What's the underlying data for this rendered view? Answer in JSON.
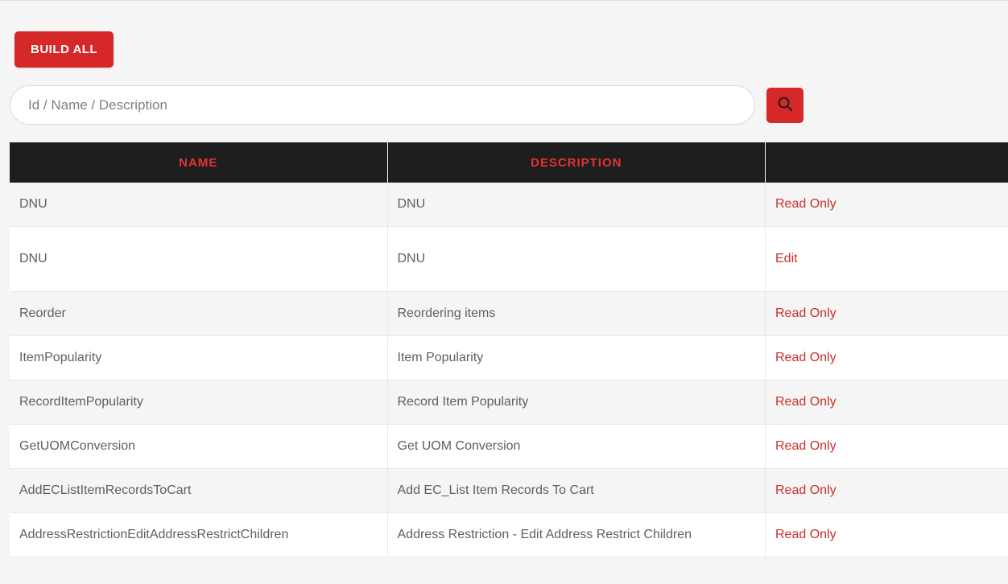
{
  "toolbar": {
    "build_all_label": "BUILD ALL"
  },
  "search": {
    "placeholder": "Id / Name / Description",
    "value": ""
  },
  "table": {
    "headers": {
      "name": "NAME",
      "description": "DESCRIPTION",
      "action": ""
    },
    "rows": [
      {
        "name": "DNU",
        "description": "DNU",
        "action": "Read Only",
        "tall": false
      },
      {
        "name": "DNU",
        "description": "DNU",
        "action": "Edit",
        "tall": true
      },
      {
        "name": "Reorder",
        "description": "Reordering items",
        "action": "Read Only",
        "tall": false
      },
      {
        "name": "ItemPopularity",
        "description": "Item Popularity",
        "action": "Read Only",
        "tall": false
      },
      {
        "name": "RecordItemPopularity",
        "description": "Record Item Popularity",
        "action": "Read Only",
        "tall": false
      },
      {
        "name": "GetUOMConversion",
        "description": "Get UOM Conversion",
        "action": "Read Only",
        "tall": false
      },
      {
        "name": "AddECListItemRecordsToCart",
        "description": "Add EC_List Item Records To Cart",
        "action": "Read Only",
        "tall": false
      },
      {
        "name": "AddressRestrictionEditAddressRestrictChildren",
        "description": "Address Restriction - Edit Address Restrict Children",
        "action": "Read Only",
        "tall": false
      }
    ]
  },
  "colors": {
    "accent": "#d62829",
    "header_bg": "#1e1e1e",
    "header_text": "#e53233",
    "row_alt": "#f5f5f5",
    "row_bg": "#ffffff",
    "link": "#c9302c"
  }
}
